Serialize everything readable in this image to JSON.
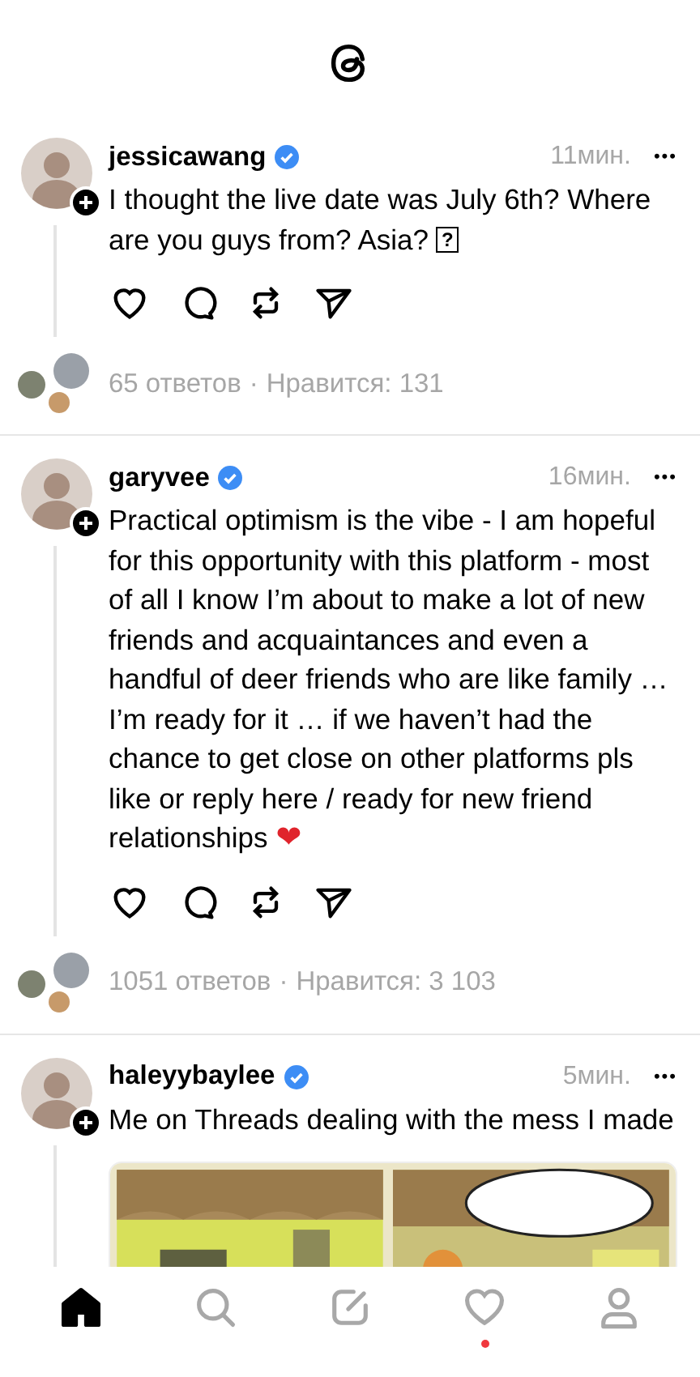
{
  "posts": [
    {
      "username": "jessicawang",
      "verified": true,
      "time": "11мин.",
      "more": "•••",
      "text": "I thought the live date was July 6th? Where are you guys from? Asia?",
      "glyph_box": "?",
      "replies": "65 ответов",
      "separator": "·",
      "likes": "Нравится: 131"
    },
    {
      "username": "garyvee",
      "verified": true,
      "time": "16мин.",
      "more": "•••",
      "text": "Practical optimism is the vibe - I am hopeful for this opportunity with this platform - most of all I know I’m about to make a lot of new friends and acquaintances and even a handful of deer friends who are like family … I’m ready for it … if we haven’t had the chance to get close on other platforms pls like or reply here / ready for new friend relationships",
      "emoji": "❤",
      "replies": "1051 ответов",
      "separator": "·",
      "likes": "Нравится: 3 103"
    },
    {
      "username": "haleyybaylee",
      "verified": true,
      "time": "5мин.",
      "more": "•••",
      "text": "Me on Threads dealing with the mess I made"
    }
  ],
  "nav": [
    {
      "kind": "home",
      "selected": true,
      "badge": false
    },
    {
      "kind": "search",
      "selected": false,
      "badge": false
    },
    {
      "kind": "compose",
      "selected": false,
      "badge": false
    },
    {
      "kind": "activity",
      "selected": false,
      "badge": true
    },
    {
      "kind": "profile",
      "selected": false,
      "badge": false
    }
  ]
}
